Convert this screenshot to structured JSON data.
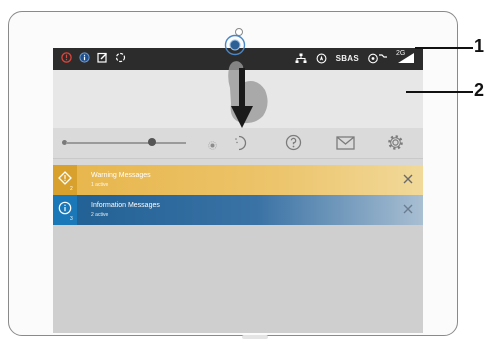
{
  "statusbar": {
    "left_icons": [
      "alert-circle-icon",
      "info-circle-icon",
      "edit-note-icon",
      "sync-icon"
    ],
    "right_icons": [
      "network-icon",
      "gps-icon",
      "sbas-label",
      "sensor-icon",
      "cellular-signal-icon"
    ],
    "sbas_label": "SBAS",
    "cellular_label": "2G"
  },
  "toolbar": {
    "brightness_level": 0.72,
    "icons": [
      "sun-icon",
      "moon-icon",
      "help-icon",
      "mail-icon",
      "gear-icon"
    ]
  },
  "messages": [
    {
      "type": "warning",
      "title": "Warning Messages",
      "subtitle": "1 active",
      "count": "2",
      "icon": "warning-diamond-icon",
      "color": "#e7b54a"
    },
    {
      "type": "info",
      "title": "Information Messages",
      "subtitle": "2 active",
      "count": "3",
      "icon": "info-circle-icon",
      "color": "#1f5f93"
    }
  ],
  "gesture": {
    "icon": "swipe-down-arrow-icon"
  },
  "callouts": [
    {
      "label": "1"
    },
    {
      "label": "2"
    }
  ]
}
